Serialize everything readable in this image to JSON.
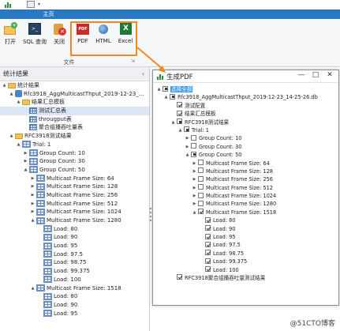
{
  "ribbon": {
    "tab_home": "主页",
    "buttons": [
      {
        "label": "打开",
        "icon": "open-folder-icon"
      },
      {
        "label": "SQL 查询",
        "icon": "terminal-icon"
      },
      {
        "label": "关闭",
        "icon": "close-db-icon"
      },
      {
        "label": "PDF",
        "icon": "pdf-icon"
      },
      {
        "label": "HTML",
        "icon": "html-icon"
      },
      {
        "label": "Excel",
        "icon": "excel-icon"
      }
    ],
    "group_label": "文件",
    "pdf_glyph": "PDF",
    "excel_glyph": "X"
  },
  "left_pane": {
    "title": "统计结果",
    "tree": [
      {
        "level": 0,
        "toggle": "▲",
        "icon": "folder",
        "label": "统计结果"
      },
      {
        "level": 1,
        "toggle": "▲",
        "icon": "db",
        "label": "Rfc3918_AggMulticastThput_2019-12-23_..."
      },
      {
        "level": 2,
        "toggle": "▲",
        "icon": "folder",
        "label": "结果汇总模板"
      },
      {
        "level": 3,
        "toggle": "",
        "icon": "table",
        "label": "测试汇总表",
        "selected": true
      },
      {
        "level": 3,
        "toggle": "",
        "icon": "table",
        "label": "througput表"
      },
      {
        "level": 3,
        "toggle": "",
        "icon": "table",
        "label": "聚合组播吞吐量表"
      },
      {
        "level": 1,
        "toggle": "▲",
        "icon": "folder",
        "label": "RFC3918测试结果"
      },
      {
        "level": 2,
        "toggle": "▲",
        "icon": "grid",
        "label": "Trial: 1"
      },
      {
        "level": 3,
        "toggle": "▶",
        "icon": "grid",
        "label": "Group Count: 10"
      },
      {
        "level": 3,
        "toggle": "▶",
        "icon": "grid",
        "label": "Group Count: 30"
      },
      {
        "level": 3,
        "toggle": "▲",
        "icon": "grid",
        "label": "Group Count: 50"
      },
      {
        "level": 4,
        "toggle": "▶",
        "icon": "grid",
        "label": "Multicast Frame Size: 64"
      },
      {
        "level": 4,
        "toggle": "▶",
        "icon": "grid",
        "label": "Multicast Frame Size: 128"
      },
      {
        "level": 4,
        "toggle": "▶",
        "icon": "grid",
        "label": "Multicast Frame Size: 256"
      },
      {
        "level": 4,
        "toggle": "▶",
        "icon": "grid",
        "label": "Multicast Frame Size: 512"
      },
      {
        "level": 4,
        "toggle": "▶",
        "icon": "grid",
        "label": "Multicast Frame Size: 1024"
      },
      {
        "level": 4,
        "toggle": "▲",
        "icon": "grid",
        "label": "Multicast Frame Size: 1280"
      },
      {
        "level": 5,
        "toggle": "",
        "icon": "grid",
        "label": "Load: 80"
      },
      {
        "level": 5,
        "toggle": "",
        "icon": "grid",
        "label": "Load: 90"
      },
      {
        "level": 5,
        "toggle": "",
        "icon": "grid",
        "label": "Load: 95"
      },
      {
        "level": 5,
        "toggle": "",
        "icon": "grid",
        "label": "Load: 97.5"
      },
      {
        "level": 5,
        "toggle": "",
        "icon": "grid",
        "label": "Load: 98.75"
      },
      {
        "level": 5,
        "toggle": "",
        "icon": "grid",
        "label": "Load: 99.375"
      },
      {
        "level": 5,
        "toggle": "",
        "icon": "grid",
        "label": "Load: 100"
      },
      {
        "level": 4,
        "toggle": "▲",
        "icon": "grid",
        "label": "Multicast Frame Size: 1518"
      },
      {
        "level": 5,
        "toggle": "",
        "icon": "grid",
        "label": "Load: 80"
      },
      {
        "level": 5,
        "toggle": "",
        "icon": "grid",
        "label": "Load: 90"
      },
      {
        "level": 5,
        "toggle": "",
        "icon": "grid",
        "label": "Load: 95"
      }
    ]
  },
  "dialog": {
    "title": "生成PDF",
    "minimize": "—",
    "maximize": "□",
    "close": "✕",
    "tree": [
      {
        "level": 0,
        "toggle": "▲",
        "check": "part",
        "label": "选择全部",
        "selected": true
      },
      {
        "level": 1,
        "toggle": "▲",
        "check": "part",
        "label": "Rfc3918_AggMulticastThput_2019-12-23_14-25-26.db"
      },
      {
        "level": 2,
        "toggle": "",
        "check": "on",
        "label": "测试配置"
      },
      {
        "level": 2,
        "toggle": "",
        "check": "on",
        "label": "结果汇总模板"
      },
      {
        "level": 2,
        "toggle": "▲",
        "check": "part",
        "label": "RFC3918测试结果"
      },
      {
        "level": 3,
        "toggle": "▲",
        "check": "part",
        "label": "Trial: 1"
      },
      {
        "level": 4,
        "toggle": "▶",
        "check": "off",
        "label": "Group Count: 10"
      },
      {
        "level": 4,
        "toggle": "▶",
        "check": "off",
        "label": "Group Count: 30"
      },
      {
        "level": 4,
        "toggle": "▲",
        "check": "part",
        "label": "Group Count: 50"
      },
      {
        "level": 5,
        "toggle": "▶",
        "check": "off",
        "label": "Multicast Frame Size: 64"
      },
      {
        "level": 5,
        "toggle": "▶",
        "check": "off",
        "label": "Multicast Frame Size: 128"
      },
      {
        "level": 5,
        "toggle": "▶",
        "check": "off",
        "label": "Multicast Frame Size: 256"
      },
      {
        "level": 5,
        "toggle": "▶",
        "check": "off",
        "label": "Multicast Frame Size: 512"
      },
      {
        "level": 5,
        "toggle": "▶",
        "check": "off",
        "label": "Multicast Frame Size: 1024"
      },
      {
        "level": 5,
        "toggle": "▶",
        "check": "off",
        "label": "Multicast Frame Size: 1280"
      },
      {
        "level": 5,
        "toggle": "▲",
        "check": "on",
        "label": "Multicast Frame Size: 1518"
      },
      {
        "level": 6,
        "toggle": "",
        "check": "on",
        "label": "Load: 80"
      },
      {
        "level": 6,
        "toggle": "",
        "check": "on",
        "label": "Load: 90"
      },
      {
        "level": 6,
        "toggle": "",
        "check": "on",
        "label": "Load: 95"
      },
      {
        "level": 6,
        "toggle": "",
        "check": "on",
        "label": "Load: 97.5"
      },
      {
        "level": 6,
        "toggle": "",
        "check": "on",
        "label": "Load: 98.75"
      },
      {
        "level": 6,
        "toggle": "",
        "check": "on",
        "label": "Load: 99.375"
      },
      {
        "level": 6,
        "toggle": "",
        "check": "on",
        "label": "Load: 100"
      },
      {
        "level": 2,
        "toggle": "",
        "check": "on",
        "label": "RFC3918聚合组播吞吐量测试结果"
      }
    ]
  },
  "watermark": "@51CTO博客",
  "colors": {
    "accent": "#2b78c2",
    "highlight": "#f08a24",
    "selection": "#3399ff"
  }
}
